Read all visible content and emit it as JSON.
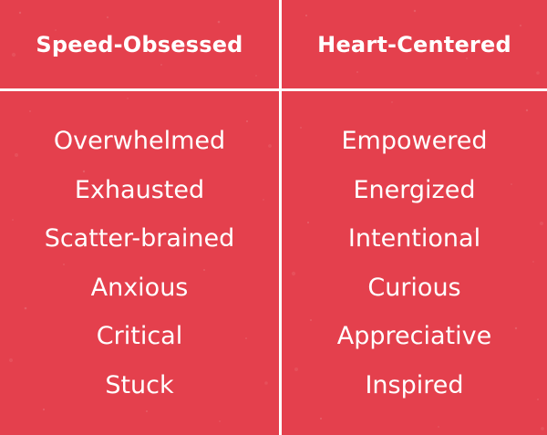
{
  "colors": {
    "background": "#e4404d",
    "divider": "#ffffff",
    "text": "#ffffff"
  },
  "columns": [
    {
      "title": "Speed-Obsessed",
      "items": [
        "Overwhelmed",
        "Exhausted",
        "Scatter-brained",
        "Anxious",
        "Critical",
        "Stuck"
      ]
    },
    {
      "title": "Heart-Centered",
      "items": [
        "Empowered",
        "Energized",
        "Intentional",
        "Curious",
        "Appreciative",
        "Inspired"
      ]
    }
  ]
}
